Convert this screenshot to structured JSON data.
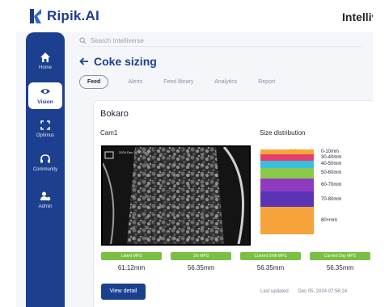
{
  "brand": {
    "logo_text": "Ripik.AI",
    "right_text": "Intelliverse"
  },
  "search": {
    "placeholder": "Search Intelliverse"
  },
  "sidebar": {
    "items": [
      {
        "label": "Home",
        "icon": "home-icon",
        "active": false
      },
      {
        "label": "Vision",
        "icon": "eye-icon",
        "active": true
      },
      {
        "label": "Optimus",
        "icon": "optimus-icon",
        "active": false
      },
      {
        "label": "Community",
        "icon": "headset-icon",
        "active": false
      },
      {
        "label": "Admin",
        "icon": "admin-icon",
        "active": false
      }
    ]
  },
  "page": {
    "title": "Coke sizing",
    "back_icon": "arrow-left-icon"
  },
  "tabs": [
    {
      "label": "Feed",
      "active": true
    },
    {
      "label": "Alerts",
      "active": false
    },
    {
      "label": "Feed library",
      "active": false
    },
    {
      "label": "Analytics",
      "active": false
    },
    {
      "label": "Report",
      "active": false
    }
  ],
  "card": {
    "plant": "Bokaro",
    "camera": "Cam1",
    "video_timestamp": "2024  Dec 05  07:58:17",
    "size_distribution_title": "Size distribution",
    "distribution": [
      {
        "pct": "5.70%",
        "range": "0-10mm",
        "color": "#f4a73a",
        "fraction": 0.057
      },
      {
        "pct": "6.38%",
        "range": "30-40mm",
        "color": "#e63d6b",
        "fraction": 0.0638
      },
      {
        "pct": "7.69%",
        "range": "40-50mm",
        "color": "#39bfe0",
        "fraction": 0.0769
      },
      {
        "pct": "11.78%",
        "range": "50-60mm",
        "color": "#8bc94b",
        "fraction": 0.1178
      },
      {
        "pct": "14.24%",
        "range": "60-70mm",
        "color": "#8e3bbf",
        "fraction": 0.1424
      },
      {
        "pct": "16.76%",
        "range": "70-80mm",
        "color": "#5b33b5",
        "fraction": 0.1676
      },
      {
        "pct": "29.30%",
        "range": "80+mm",
        "color": "#f5a33a",
        "fraction": 0.293
      }
    ],
    "metrics": [
      {
        "label": "Latest MPS",
        "value": "61.12mm"
      },
      {
        "label": "1hr MPS",
        "value": "56.35mm"
      },
      {
        "label": "Current Shift MPS",
        "value": "56.35mm"
      },
      {
        "label": "Current Day MPS",
        "value": "56.35mm"
      }
    ],
    "view_button": "View detail",
    "last_updated_label": "Last updated",
    "last_updated_value": "Dec 05, 2024   07:58:24"
  },
  "colors": {
    "sidebar": "#1c3f8f",
    "accent": "#1c3f8f",
    "metric_green": "#7bc043"
  }
}
